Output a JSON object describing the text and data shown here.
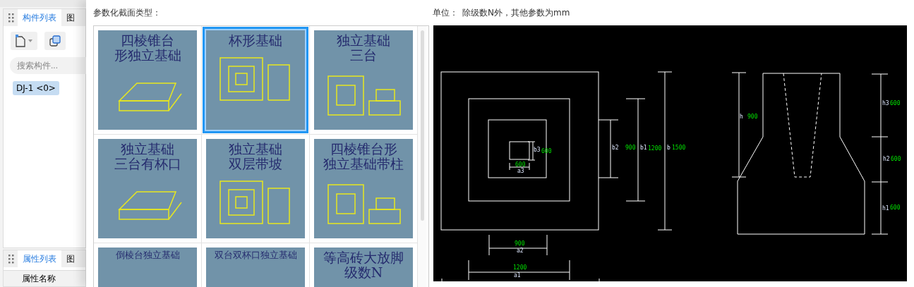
{
  "left_panel": {
    "tabs": [
      {
        "label": "构件列表",
        "selected": true
      },
      {
        "label": "图",
        "selected": false
      }
    ],
    "search": {
      "placeholder": "搜索构件..."
    },
    "items": [
      {
        "label": "DJ-1 <0>",
        "selected": true
      }
    ]
  },
  "lower_panel": {
    "tabs": [
      {
        "label": "属性列表",
        "selected": true
      },
      {
        "label": "图",
        "selected": false
      }
    ],
    "columns": [
      "属性名称"
    ]
  },
  "dialog": {
    "section_type_label": "参数化截面类型：",
    "unit_label": "单位：",
    "unit_note": "除级数N外，其他参数为mm",
    "tiles": [
      {
        "title_lines": [
          "四棱锥台",
          "形独立基础"
        ],
        "selected": false
      },
      {
        "title_lines": [
          "杯形基础"
        ],
        "selected": true
      },
      {
        "title_lines": [
          "独立基础",
          "三台"
        ],
        "selected": false
      },
      {
        "title_lines": [
          "独立基础",
          "三台有杯口"
        ],
        "selected": false
      },
      {
        "title_lines": [
          "独立基础",
          "双层带坡"
        ],
        "selected": false
      },
      {
        "title_lines": [
          "四棱锥台形",
          "独立基础带柱"
        ],
        "selected": false
      },
      {
        "title_lines": [
          "倒棱台独立基础"
        ],
        "selected": false
      },
      {
        "title_lines": [
          "双台双杯口独立基础"
        ],
        "selected": false
      },
      {
        "title_lines": [
          "等高砖大放脚",
          "级数N"
        ],
        "selected": false
      }
    ],
    "plan_dims": [
      {
        "name": "b3",
        "value": "600"
      },
      {
        "name": "a3",
        "value": "600"
      },
      {
        "name": "b2",
        "value": "900"
      },
      {
        "name": "b1",
        "value": "1200"
      },
      {
        "name": "b",
        "value": "1500"
      },
      {
        "name": "a2",
        "value": "900"
      },
      {
        "name": "a1",
        "value": "1200"
      }
    ],
    "section_dims": [
      {
        "name": "h",
        "value": "900"
      },
      {
        "name": "h3",
        "value": "600"
      },
      {
        "name": "h2",
        "value": "600"
      },
      {
        "name": "h1",
        "value": "600"
      }
    ]
  }
}
